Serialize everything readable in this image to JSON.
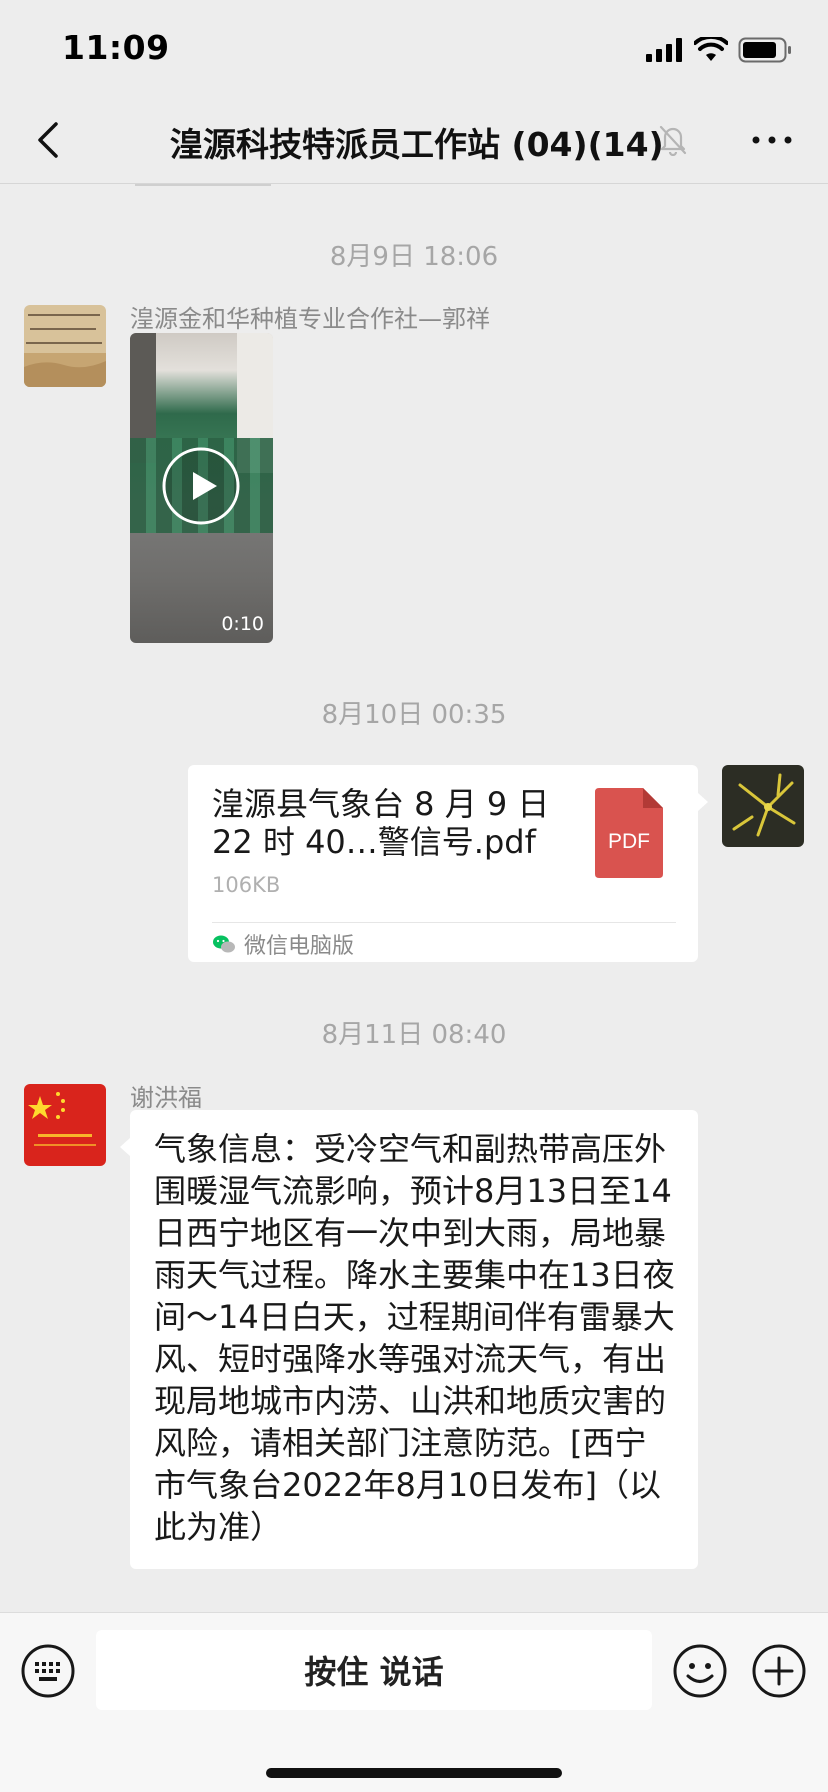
{
  "status_bar": {
    "time": "11:09"
  },
  "nav": {
    "title": "湟源科技特派员工作站 (04)(14)"
  },
  "messages": [
    {
      "timestamp": "8月9日 18:06",
      "sender": "湟源金和华种植专业合作社—郭祥",
      "type": "video",
      "duration": "0:10"
    },
    {
      "timestamp": "8月10日 00:35",
      "type": "file",
      "file_name": "湟源县气象台 8 月 9 日 22 时 40…警信号.pdf",
      "file_badge": "PDF",
      "file_size": "106KB",
      "source": "微信电脑版"
    },
    {
      "timestamp": "8月11日 08:40",
      "sender": "谢洪福",
      "type": "text",
      "text": "气象信息：受冷空气和副热带高压外围暖湿气流影响，预计8月13日至14日西宁地区有一次中到大雨，局地暴雨天气过程。降水主要集中在13日夜间～14日白天，过程期间伴有雷暴大风、短时强降水等强对流天气，有出现局地城市内涝、山洪和地质灾害的风险，请相关部门注意防范。[西宁市气象台2022年8月10日发布]（以此为准）"
    }
  ],
  "input_bar": {
    "voice_label": "按住 说话"
  },
  "colors": {
    "background": "#ededed",
    "pdf_red": "#d9534f",
    "wechat_green": "#07c160"
  }
}
